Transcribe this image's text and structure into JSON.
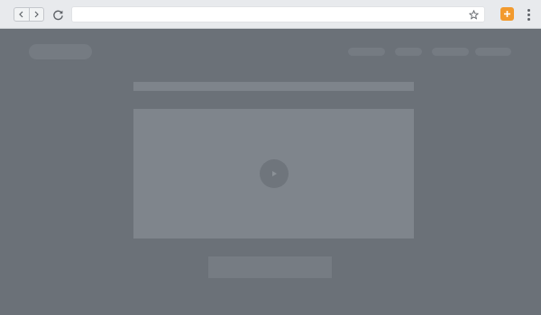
{
  "browser": {
    "address_bar": {
      "value": "",
      "placeholder": ""
    },
    "icons": {
      "back": "chevron-left-icon",
      "forward": "chevron-right-icon",
      "reload": "reload-icon",
      "bookmark": "star-icon",
      "extension": "plus-icon",
      "menu": "more-vertical-icon"
    },
    "colors": {
      "extension_accent": "#f29a2e",
      "chrome_bg": "#e8eaed"
    }
  },
  "page": {
    "state": "loading-skeleton-dimmed",
    "colors": {
      "overlay": "#6b7178",
      "skeleton": "#757b82",
      "video_placeholder": "#7f858c"
    },
    "icons": {
      "video": "play-icon"
    }
  }
}
